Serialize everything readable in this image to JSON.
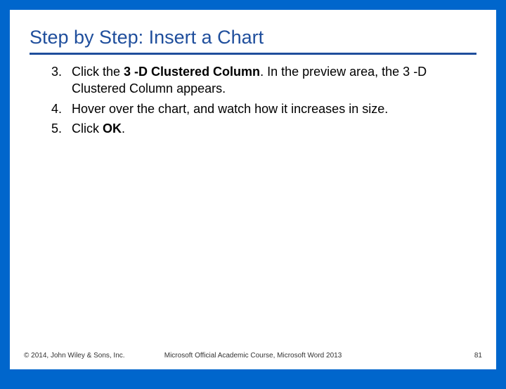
{
  "title": "Step by Step: Insert a Chart",
  "steps": [
    {
      "num": "3.",
      "pre": "Click the ",
      "b1": "3 -D Clustered Column",
      "mid": ". In the preview area, the 3 -D Clustered Column appears.",
      "b2": "",
      "post": ""
    },
    {
      "num": "4.",
      "pre": "Hover over the chart, and watch how it increases in size.",
      "b1": "",
      "mid": "",
      "b2": "",
      "post": ""
    },
    {
      "num": "5.",
      "pre": "Click ",
      "b1": "OK",
      "mid": ".",
      "b2": "",
      "post": ""
    }
  ],
  "footer": {
    "left": "© 2014, John Wiley & Sons, Inc.",
    "center": "Microsoft Official Academic Course, Microsoft Word 2013",
    "right": "81"
  }
}
